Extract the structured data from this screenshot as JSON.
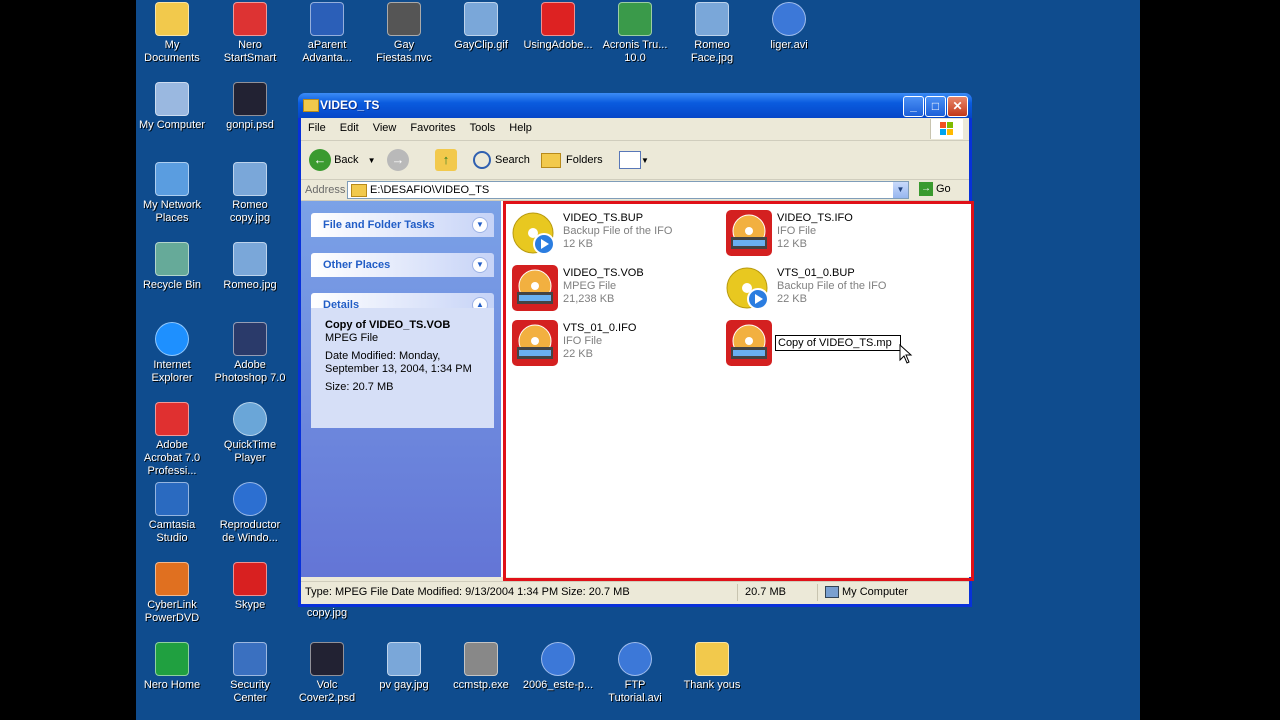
{
  "desktop": {
    "icons": [
      {
        "label": "My Documents",
        "icon": "my-documents-icon"
      },
      {
        "label": "Nero StartSmart",
        "icon": "nero-icon"
      },
      {
        "label": "aParent Advanta...",
        "icon": "word-doc-icon"
      },
      {
        "label": "Gay Fiestas.nvc",
        "icon": "film-reel-icon"
      },
      {
        "label": "GayClip.gif",
        "icon": "image-file-icon"
      },
      {
        "label": "UsingAdobe...",
        "icon": "pdf-icon"
      },
      {
        "label": "Acronis Tru... 10.0",
        "icon": "acronis-icon"
      },
      {
        "label": "Romeo Face.jpg",
        "icon": "image-file-icon"
      },
      {
        "label": "liger.avi",
        "icon": "media-file-icon"
      },
      {
        "label": "My Computer",
        "icon": "my-computer-icon"
      },
      {
        "label": "gonpi.psd",
        "icon": "psd-file-icon"
      },
      {
        "label": "My Network Places",
        "icon": "network-places-icon"
      },
      {
        "label": "Romeo copy.jpg",
        "icon": "image-file-icon"
      },
      {
        "label": "Recycle Bin",
        "icon": "recycle-bin-icon"
      },
      {
        "label": "Romeo.jpg",
        "icon": "image-file-icon"
      },
      {
        "label": "Internet Explorer",
        "icon": "internet-explorer-icon"
      },
      {
        "label": "Adobe Photoshop 7.0",
        "icon": "photoshop-icon"
      },
      {
        "label": "Adobe Acrobat 7.0 Professi...",
        "icon": "acrobat-icon"
      },
      {
        "label": "QuickTime Player",
        "icon": "quicktime-icon"
      },
      {
        "label": "Camtasia Studio",
        "icon": "camtasia-icon"
      },
      {
        "label": "Reproductor de Windo...",
        "icon": "media-player-icon"
      },
      {
        "label": "CyberLink PowerDVD",
        "icon": "powerdvd-icon"
      },
      {
        "label": "Skype",
        "icon": "skype-icon"
      },
      {
        "label": "copy.jpg",
        "icon": "image-file-icon"
      },
      {
        "label": "Nero Home",
        "icon": "nero-home-icon"
      },
      {
        "label": "Security Center",
        "icon": "security-center-icon"
      },
      {
        "label": "Volc Cover2.psd",
        "icon": "psd-file-icon"
      },
      {
        "label": "pv gay.jpg",
        "icon": "image-file-icon"
      },
      {
        "label": "ccmstp.exe",
        "icon": "exe-file-icon"
      },
      {
        "label": "2006_este-p...",
        "icon": "media-file-icon"
      },
      {
        "label": "FTP Tutorial.avi",
        "icon": "media-file-icon"
      },
      {
        "label": "Thank yous",
        "icon": "folder-icon"
      }
    ]
  },
  "window": {
    "title": "VIDEO_TS",
    "controls": {
      "minimize": "_",
      "maximize": "□",
      "close": "✕"
    },
    "menu": [
      "File",
      "Edit",
      "View",
      "Favorites",
      "Tools",
      "Help"
    ],
    "toolbar": {
      "back": "Back",
      "search": "Search",
      "folders": "Folders"
    },
    "address": {
      "label": "Address",
      "value": "E:\\DESAFIO\\VIDEO_TS",
      "go": "Go"
    },
    "taskpane": {
      "file_folder_tasks": "File and Folder Tasks",
      "other_places": "Other Places",
      "details": "Details",
      "detail_name": "Copy of VIDEO_TS.VOB",
      "detail_type": "MPEG File",
      "detail_modified_1": "Date Modified: Monday,",
      "detail_modified_2": "September 13, 2004, 1:34 PM",
      "detail_size": "Size: 20.7 MB"
    },
    "files": [
      {
        "name": "VIDEO_TS.BUP",
        "type": "Backup File of the IFO",
        "size": "12 KB",
        "icon": "dvd-backup-icon"
      },
      {
        "name": "VIDEO_TS.IFO",
        "type": "IFO File",
        "size": "12 KB",
        "icon": "dvd-video-icon"
      },
      {
        "name": "VIDEO_TS.VOB",
        "type": "MPEG File",
        "size": "21,238 KB",
        "icon": "dvd-video-icon"
      },
      {
        "name": "VTS_01_0.BUP",
        "type": "Backup File of the IFO",
        "size": "22 KB",
        "icon": "dvd-backup-icon"
      },
      {
        "name": "VTS_01_0.IFO",
        "type": "IFO File",
        "size": "22 KB",
        "icon": "dvd-video-icon"
      }
    ],
    "rename_value": "Copy of VIDEO_TS.mp",
    "status": {
      "text": "Type: MPEG File Date Modified: 9/13/2004 1:34 PM Size: 20.7 MB",
      "size": "20.7 MB",
      "zone": "My Computer"
    }
  }
}
